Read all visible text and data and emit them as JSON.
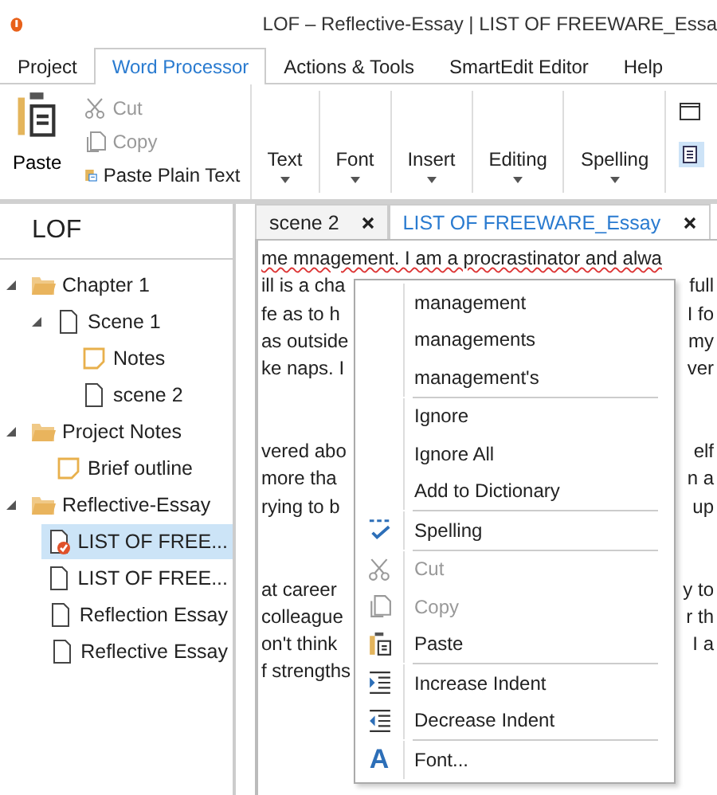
{
  "window": {
    "title": "LOF – Reflective-Essay | LIST OF FREEWARE_Essa"
  },
  "ribbon_tabs": [
    {
      "label": "Project",
      "selected": false
    },
    {
      "label": "Word Processor",
      "selected": true
    },
    {
      "label": "Actions & Tools",
      "selected": false
    },
    {
      "label": "SmartEdit Editor",
      "selected": false
    },
    {
      "label": "Help",
      "selected": false
    }
  ],
  "clipboard": {
    "paste": "Paste",
    "cut": {
      "label": "Cut",
      "disabled": true
    },
    "copy": {
      "label": "Copy",
      "disabled": true
    },
    "paste_plain": "Paste Plain Text"
  },
  "ribbon_groups": [
    "Text",
    "Font",
    "Insert",
    "Editing",
    "Spelling"
  ],
  "binder": {
    "title": "LOF",
    "items": [
      {
        "label": "Chapter 1",
        "kind": "folder",
        "expanded": true,
        "selected": false,
        "children": [
          {
            "label": "Scene 1",
            "kind": "doc",
            "expanded": true,
            "selected": false,
            "children": [
              {
                "label": "Notes",
                "kind": "note",
                "selected": false
              },
              {
                "label": "scene 2",
                "kind": "doc",
                "selected": false
              }
            ]
          }
        ]
      },
      {
        "label": "Project Notes",
        "kind": "folder",
        "expanded": true,
        "selected": false,
        "children": [
          {
            "label": "Brief outline",
            "kind": "note",
            "selected": false
          }
        ]
      },
      {
        "label": "Reflective-Essay",
        "kind": "folder",
        "expanded": true,
        "selected": false,
        "children": [
          {
            "label": "LIST OF FREE...",
            "kind": "checked-doc",
            "selected": true
          },
          {
            "label": "LIST OF FREE...",
            "kind": "doc",
            "selected": false
          },
          {
            "label": "Reflection Essay",
            "kind": "doc",
            "selected": false
          },
          {
            "label": "Reflective Essay",
            "kind": "doc",
            "selected": false
          }
        ]
      }
    ]
  },
  "editor_tabs": [
    {
      "label": "scene 2",
      "selected": false
    },
    {
      "label": "LIST OF FREEWARE_Essay",
      "selected": true
    }
  ],
  "document_paragraphs": [
    [
      {
        "left": "me mnagement. I am a procrastinator and alwa"
      },
      {
        "left": "ill is a cha",
        "right": "full"
      },
      {
        "left": "fe as to h",
        "right": "I fo"
      },
      {
        "left": "as outside",
        "right": "my"
      },
      {
        "left": "ke naps. I",
        "right": "ver"
      }
    ],
    [
      {
        "left": "vered abo",
        "right": "elf"
      },
      {
        "left": "more  tha",
        "right": "n a"
      },
      {
        "left": "rying to b",
        "right": "up"
      }
    ],
    [
      {
        "left": "at career",
        "right": "y to"
      },
      {
        "left": "colleague",
        "right": "r th"
      },
      {
        "left": "on't think",
        "right": "I a"
      },
      {
        "left": "f strengths"
      }
    ]
  ],
  "context_menu": {
    "groups": [
      [
        {
          "label": "management",
          "kind": "suggestion",
          "disabled": false
        },
        {
          "label": "managements",
          "kind": "suggestion",
          "disabled": false
        },
        {
          "label": "management's",
          "kind": "suggestion",
          "disabled": false
        }
      ],
      [
        {
          "label": "Ignore",
          "kind": "command",
          "disabled": false
        },
        {
          "label": "Ignore All",
          "kind": "command",
          "disabled": false
        },
        {
          "label": "Add to Dictionary",
          "kind": "command",
          "disabled": false
        }
      ],
      [
        {
          "label": "Spelling",
          "kind": "spelling",
          "disabled": false
        }
      ],
      [
        {
          "label": "Cut",
          "kind": "cut",
          "disabled": true
        },
        {
          "label": "Copy",
          "kind": "copy",
          "disabled": true
        },
        {
          "label": "Paste",
          "kind": "paste",
          "disabled": false
        }
      ],
      [
        {
          "label": "Increase Indent",
          "kind": "indent-increase",
          "disabled": false
        },
        {
          "label": "Decrease Indent",
          "kind": "indent-decrease",
          "disabled": false
        }
      ],
      [
        {
          "label": "Font...",
          "kind": "font",
          "icon_text": "A",
          "disabled": false
        }
      ]
    ]
  }
}
